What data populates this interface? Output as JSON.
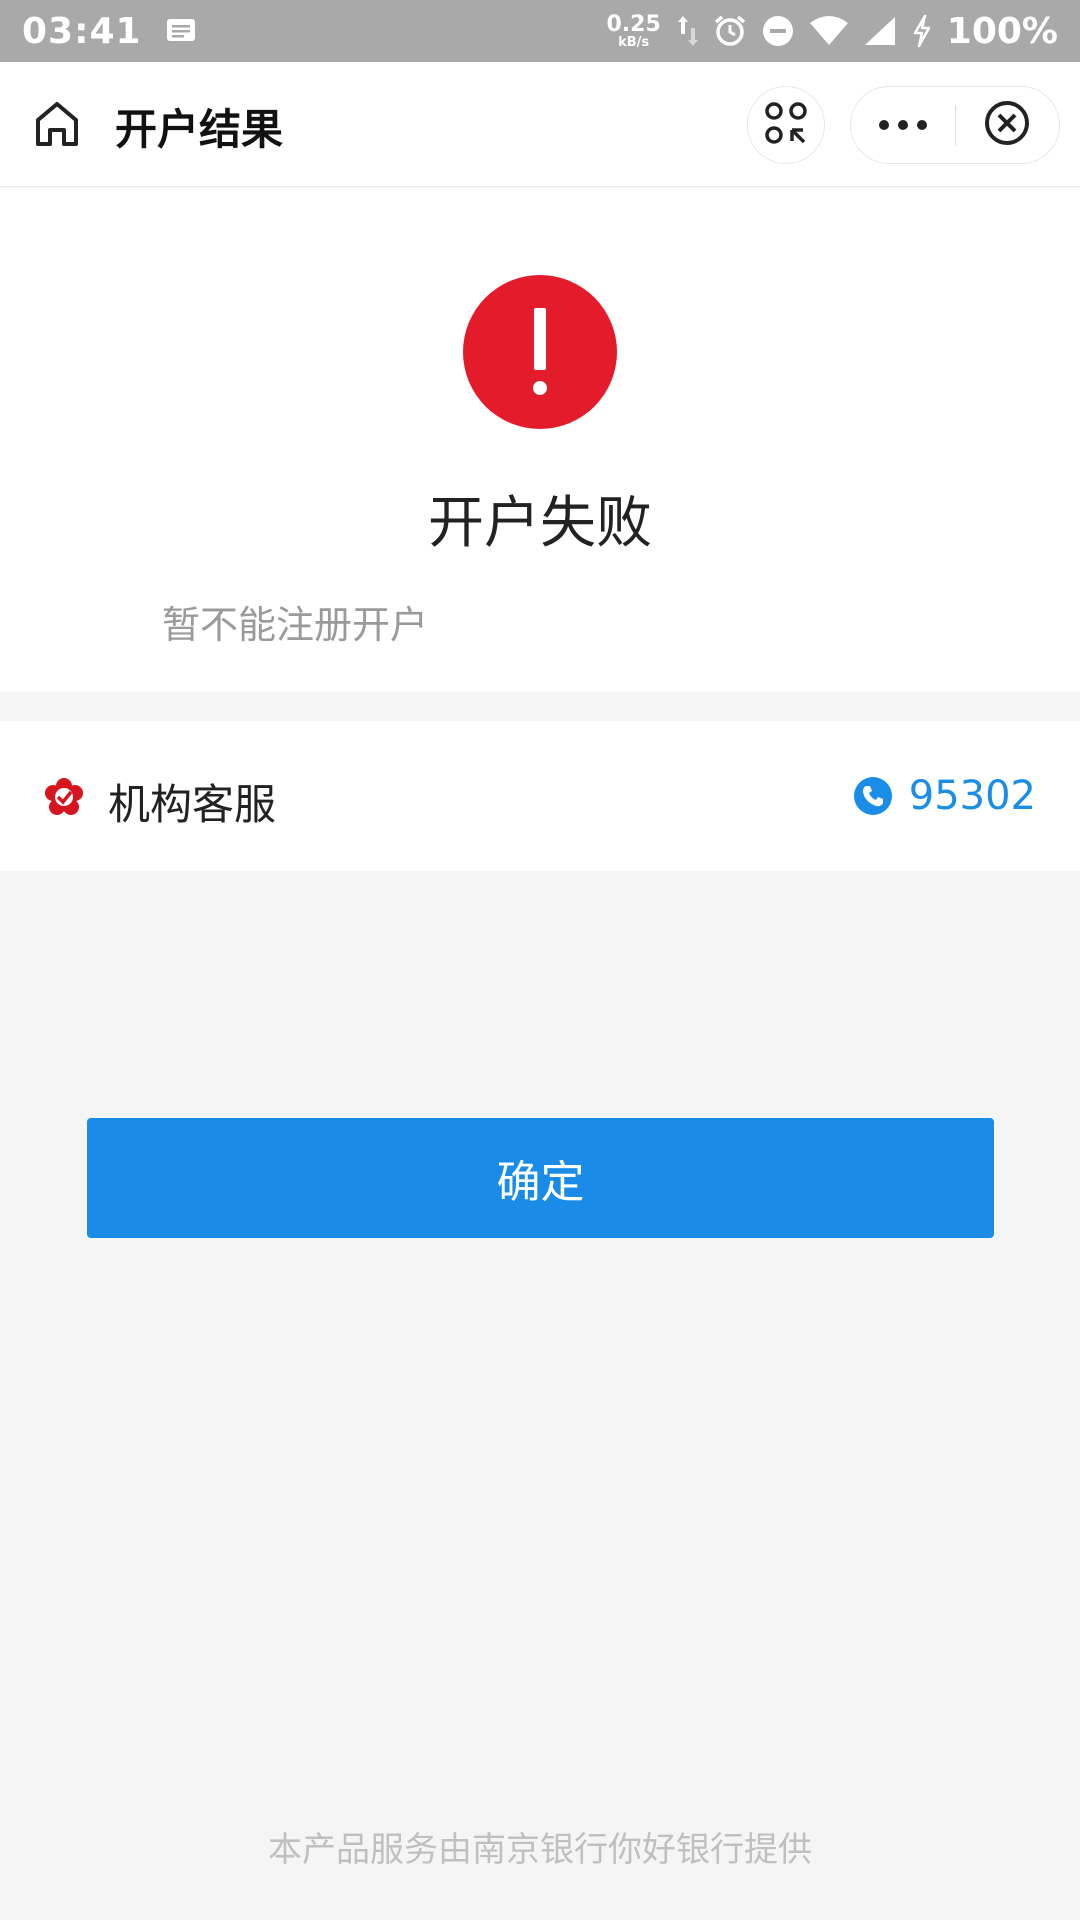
{
  "status_bar": {
    "time": "03:41",
    "net_speed_value": "0.25",
    "net_speed_unit": "kB/s",
    "battery": "100%",
    "icons": [
      "message-icon",
      "upload-download-icon",
      "alarm-icon",
      "dnd-icon",
      "wifi-icon",
      "signal-icon",
      "charging-icon"
    ]
  },
  "header": {
    "title": "开户结果",
    "icons": [
      "home-icon",
      "scan-icon",
      "more-icon",
      "close-icon"
    ]
  },
  "result": {
    "title": "开户失败",
    "description": "暂不能注册开户",
    "status_color": "#e31b2b"
  },
  "service": {
    "label": "机构客服",
    "phone": "95302",
    "accent_color": "#1a8ee6"
  },
  "actions": {
    "confirm_label": "确定",
    "button_color": "#1a8ce8"
  },
  "footer": {
    "note": "本产品服务由南京银行你好银行提供"
  }
}
